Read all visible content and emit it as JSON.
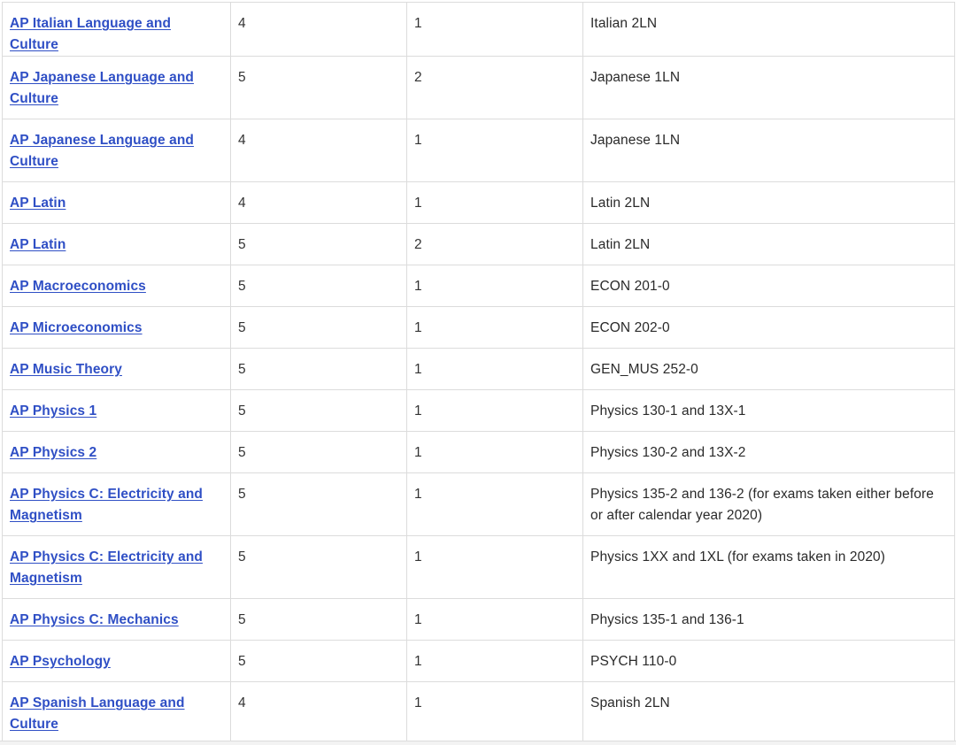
{
  "rows": [
    {
      "exam": "AP Italian Language and Culture",
      "score": "4",
      "credits": "1",
      "equivalent": "Italian 2LN"
    },
    {
      "exam": "AP Japanese Language and Culture",
      "score": "5",
      "credits": "2",
      "equivalent": "Japanese 1LN"
    },
    {
      "exam": "AP Japanese Language and Culture",
      "score": "4",
      "credits": "1",
      "equivalent": "Japanese 1LN"
    },
    {
      "exam": "AP Latin",
      "score": "4",
      "credits": "1",
      "equivalent": "Latin 2LN"
    },
    {
      "exam": "AP Latin",
      "score": "5",
      "credits": "2",
      "equivalent": "Latin 2LN"
    },
    {
      "exam": "AP Macroeconomics",
      "score": "5",
      "credits": "1",
      "equivalent": "ECON 201-0"
    },
    {
      "exam": "AP Microeconomics",
      "score": "5",
      "credits": "1",
      "equivalent": "ECON 202-0"
    },
    {
      "exam": "AP Music Theory",
      "score": "5",
      "credits": "1",
      "equivalent": "GEN_MUS 252-0"
    },
    {
      "exam": "AP Physics 1",
      "score": "5",
      "credits": "1",
      "equivalent": "Physics 130-1 and 13X-1"
    },
    {
      "exam": "AP Physics 2",
      "score": "5",
      "credits": "1",
      "equivalent": "Physics 130-2 and 13X-2"
    },
    {
      "exam": "AP Physics C: Electricity and Magnetism",
      "score": "5",
      "credits": "1",
      "equivalent": "Physics 135-2 and 136-2 (for exams taken either before or after calendar year 2020)"
    },
    {
      "exam": "AP Physics C: Electricity and Magnetism",
      "score": "5",
      "credits": "1",
      "equivalent": "Physics 1XX and 1XL (for exams taken in 2020)"
    },
    {
      "exam": "AP Physics C: Mechanics",
      "score": "5",
      "credits": "1",
      "equivalent": "Physics 135-1 and 136-1"
    },
    {
      "exam": "AP Psychology",
      "score": "5",
      "credits": "1",
      "equivalent": "PSYCH 110-0"
    },
    {
      "exam": "AP Spanish Language and Culture",
      "score": "4",
      "credits": "1",
      "equivalent": "Spanish 2LN"
    }
  ]
}
